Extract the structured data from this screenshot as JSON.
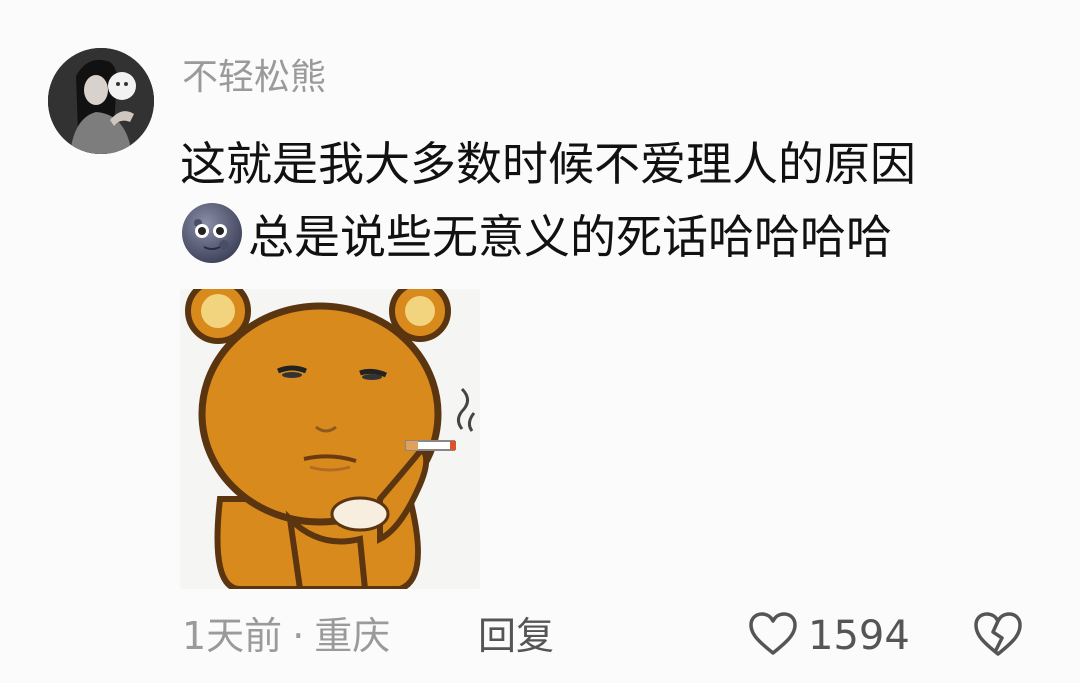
{
  "comment": {
    "username": "不轻松熊",
    "text_line1": "这就是我大多数时候不爱理人的原因",
    "text_line2": "总是说些无意义的死话哈哈哈哈",
    "time": "1天前",
    "separator": "·",
    "location": "重庆",
    "reply_label": "回复",
    "like_count": "1594"
  },
  "icons": {
    "avatar": "avatar",
    "emoji": "new-moon-face-icon",
    "sticker": "bear-smoking-sticker",
    "like": "heart-outline-icon",
    "dislike": "broken-heart-icon"
  },
  "colors": {
    "background": "#fbfbfb",
    "text_primary": "#111111",
    "text_secondary": "#9a9a9a",
    "icon": "#555555",
    "bear": "#d98a1c"
  }
}
